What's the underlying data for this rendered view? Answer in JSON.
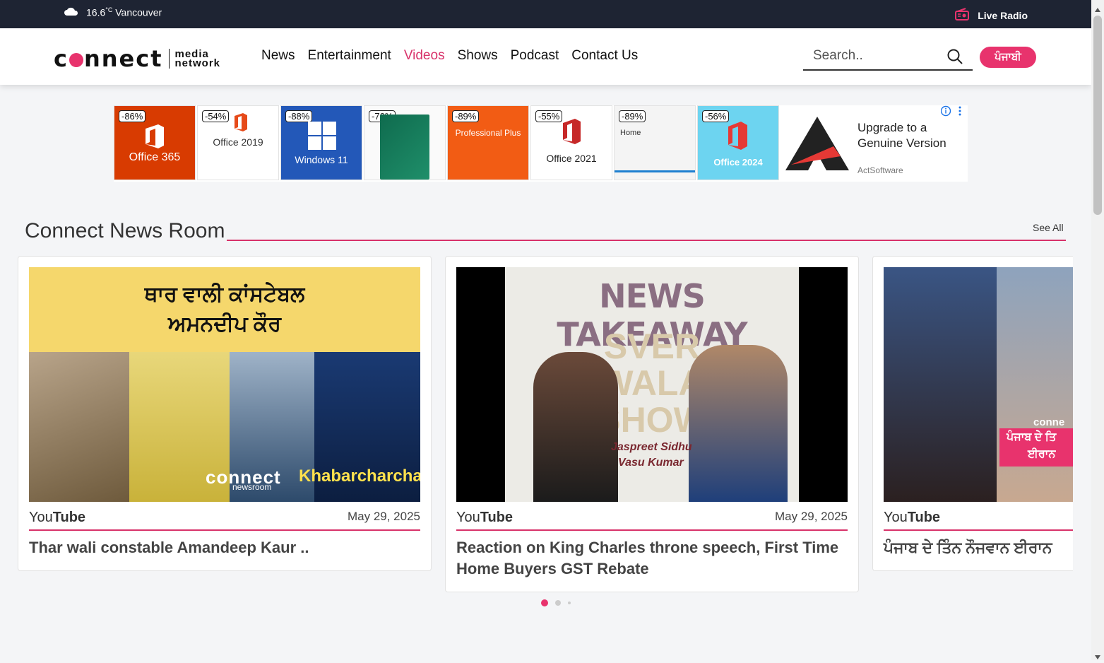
{
  "topbar": {
    "temperature": "16.6",
    "unit": "°C",
    "city": "Vancouver",
    "radio_label": "Live Radio"
  },
  "brand": {
    "word_pre": "c",
    "word_post": "nnect",
    "sub1": "media",
    "sub2": "network",
    "accent": "#e8336d"
  },
  "nav": [
    "News",
    "Entertainment",
    "Videos",
    "Shows",
    "Podcast",
    "Contact Us"
  ],
  "search": {
    "placeholder": "Search.."
  },
  "lang_button": "ਪੰਜਾਬੀ",
  "ads": {
    "tiles": [
      {
        "discount": "-86%",
        "label": "Office 365"
      },
      {
        "discount": "-54%",
        "label": "Office 2019"
      },
      {
        "discount": "-88%",
        "label": "Windows 11"
      },
      {
        "discount": "-76%",
        "label": ""
      },
      {
        "discount": "-89%",
        "label": "Professional Plus"
      },
      {
        "discount": "-55%",
        "label": "Office 2021"
      },
      {
        "discount": "-89%",
        "label": "Home"
      },
      {
        "discount": "-56%",
        "label": "Office 2024"
      }
    ],
    "headline": "Upgrade to a Genuine Version",
    "sponsor": "ActSoftware"
  },
  "section": {
    "title": "Connect News Room",
    "see_all": "See All"
  },
  "cards": [
    {
      "source_pre": "You",
      "source_post": "Tube",
      "date": "May 29, 2025",
      "title": "Thar wali constable Amandeep Kaur ..",
      "thumb_banner": "ਥਾਰ ਵਾਲੀ ਕਾਂਸਟੇਬਲ",
      "thumb_banner2": "ਅਮਨਦੀਪ ਕੌਰ",
      "thumb_brand": "connect",
      "thumb_brand_sub": "newsroom",
      "thumb_tag": "Khabarcharcha"
    },
    {
      "source_pre": "You",
      "source_post": "Tube",
      "date": "May 29, 2025",
      "title": "Reaction on King Charles throne speech, First Time Home Buyers GST Rebate",
      "thumb_banner": "NEWS TAKEAWAY",
      "thumb_show1": "SVER",
      "thumb_show2": "WALA",
      "thumb_show3": "SHOW",
      "thumb_host1": "Jaspreet Sidhu",
      "thumb_host2": "Vasu Kumar"
    },
    {
      "source_pre": "You",
      "source_post": "Tube",
      "date": "",
      "title": "ਪੰਜਾਬ ਦੇ ਤਿੰਨ ਨੌਜਵਾਨ ਈਰਾਨ",
      "thumb_brand": "conne",
      "thumb_caption1": "ਪੰਜਾਬ ਦੇ ਤਿ",
      "thumb_caption2": "ਈਰਾਨ"
    }
  ]
}
